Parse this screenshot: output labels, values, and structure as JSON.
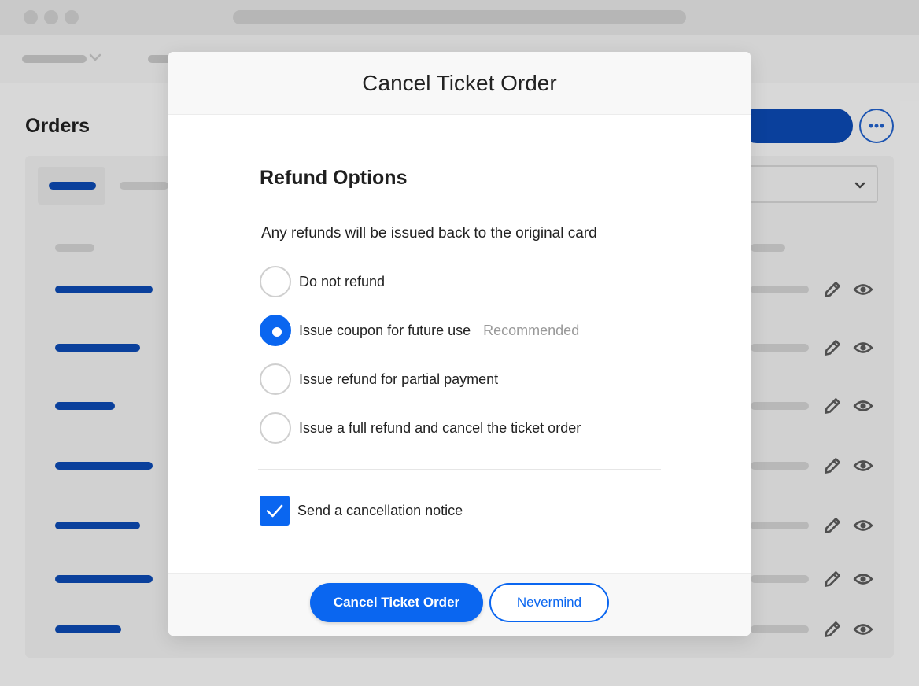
{
  "background": {
    "page_title": "Orders"
  },
  "modal": {
    "title": "Cancel Ticket Order",
    "section_title": "Refund Options",
    "subtitle": "Any refunds will be issued back to the original card",
    "options": [
      {
        "label": "Do not refund",
        "selected": false,
        "tag": ""
      },
      {
        "label": "Issue coupon for future use",
        "selected": true,
        "tag": "Recommended"
      },
      {
        "label": "Issue refund for partial payment",
        "selected": false,
        "tag": ""
      },
      {
        "label": "Issue a full refund and cancel the ticket order",
        "selected": false,
        "tag": ""
      }
    ],
    "notice_checkbox": {
      "label": "Send a cancellation notice",
      "checked": true
    },
    "primary_button": "Cancel Ticket Order",
    "secondary_button": "Nevermind"
  },
  "colors": {
    "accent": "#0a66f0",
    "background_accent": "#0b45a8"
  },
  "icons": [
    "chevron-down-icon",
    "more-icon",
    "pencil-icon",
    "eye-icon",
    "check-icon"
  ]
}
